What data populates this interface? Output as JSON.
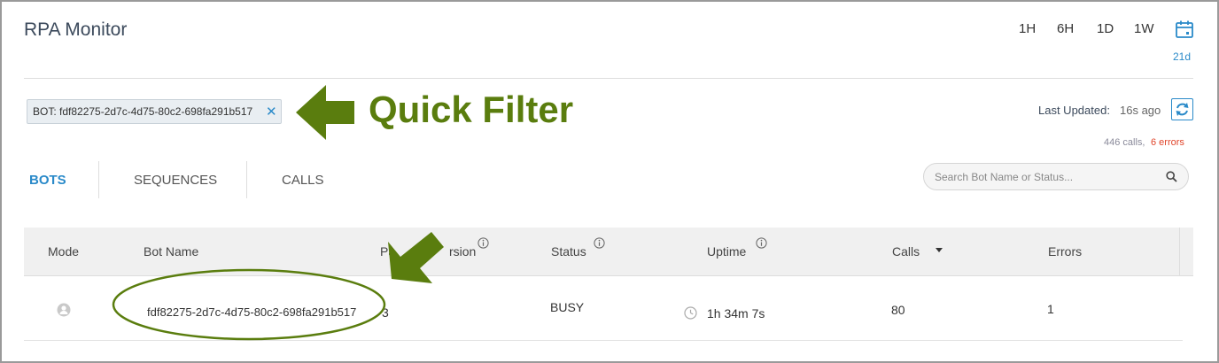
{
  "app": {
    "title": "RPA Monitor"
  },
  "time_range": {
    "options": [
      "1H",
      "6H",
      "1D",
      "1W"
    ],
    "calendar_icon": "calendar-icon",
    "custom_label": "21d"
  },
  "filter_chip": {
    "label": "BOT: fdf82275-2d7c-4d75-80c2-698fa291b517",
    "remove_icon": "close-icon"
  },
  "annotation": {
    "text": "Quick Filter",
    "color": "#5a7d0e"
  },
  "status_bar": {
    "last_updated_label": "Last Updated:",
    "last_updated_value": "16s ago",
    "refresh_icon": "refresh-icon",
    "calls_text": "446 calls,",
    "errors_text": "6 errors",
    "errors_color": "#e0452a"
  },
  "tabs": [
    {
      "label": "BOTS",
      "active": true
    },
    {
      "label": "SEQUENCES",
      "active": false
    },
    {
      "label": "CALLS",
      "active": false
    }
  ],
  "search": {
    "placeholder": "Search Bot Name or Status..."
  },
  "table": {
    "columns": [
      {
        "label": "Mode"
      },
      {
        "label": "Bot Name"
      },
      {
        "label": "Package Version",
        "visible_text": "Pa",
        "visible_tail": "rsion",
        "info": true
      },
      {
        "label": "Status",
        "info": true
      },
      {
        "label": "Uptime",
        "info": true
      },
      {
        "label": "Calls",
        "sort": "desc"
      },
      {
        "label": "Errors"
      }
    ],
    "rows": [
      {
        "mode_icon": "user-icon",
        "bot_name": "fdf82275-2d7c-4d75-80c2-698fa291b517",
        "package_version": "3",
        "status": "BUSY",
        "uptime": "1h 34m 7s",
        "calls": "80",
        "errors": "1"
      }
    ]
  },
  "colors": {
    "accent": "#2a8ac9",
    "annotation_green": "#5a7d0e"
  }
}
